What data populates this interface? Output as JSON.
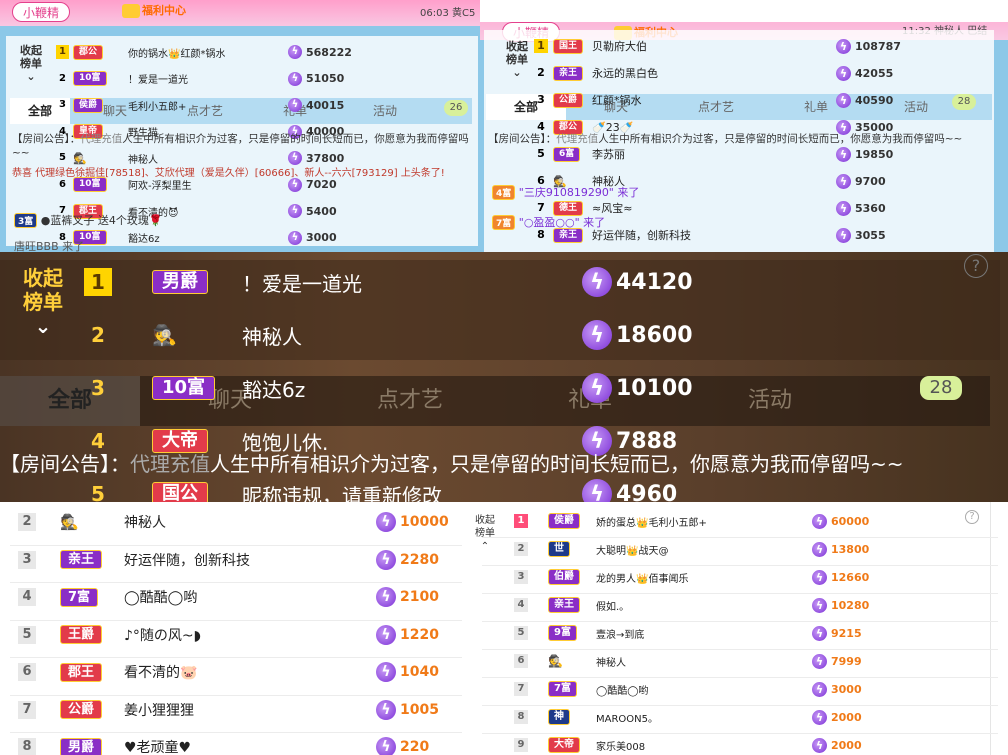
{
  "panel1": {
    "pill": "小鞭精",
    "welfare": "福利中心",
    "clock": "06:03",
    "clock_suffix": "黄C5",
    "collapse": "收起\n榜单",
    "tabs": [
      "全部",
      "聊天",
      "点才艺",
      "礼单",
      "活动"
    ],
    "tab_count": "26",
    "rows": [
      {
        "rank": "1",
        "badge": "郡公",
        "name": "你的锅水👑红颜*锅水",
        "score": "568222"
      },
      {
        "rank": "2",
        "badge": "10富",
        "name": "！爱是一道光",
        "score": "51050"
      },
      {
        "rank": "3",
        "badge": "侯爵",
        "name": "毛利小五郎+",
        "score": "40015"
      },
      {
        "rank": "4",
        "badge": "皇帝",
        "name": "野生猫",
        "score": "40000"
      },
      {
        "rank": "5",
        "badge": "",
        "name": "神秘人",
        "score": "37800"
      },
      {
        "rank": "6",
        "badge": "10富",
        "name": "阿欢-浮梨里生",
        "score": "7020"
      },
      {
        "rank": "7",
        "badge": "郡王",
        "name": "看不清的😈",
        "score": "5400"
      },
      {
        "rank": "8",
        "badge": "10富",
        "name": "豁达6z",
        "score": "3000"
      }
    ],
    "notice": "【房间公告】：",
    "notice_vip": "代理充值",
    "notice_text": "人生中所有相识介为过客，只是停留的时间长短而已，你愿意为我而停留吗~~",
    "congrats": "恭喜 代理绿色徐掘佳[78518]、艾欣代理（爱是久伴）[60666]、新人--六六[793129] 上头条了!",
    "chat1_badge": "3富",
    "chat1": "●蓝裤叉子 送4个玫瑰🌹",
    "chat2": "唐旺BBB 来了"
  },
  "panel2": {
    "pill": "小鞭精",
    "welfare": "福利中心",
    "clock": "11:32",
    "clock_suffix": "神秘人 巴结",
    "collapse": "收起\n榜单",
    "tabs": [
      "全部",
      "聊天",
      "点才艺",
      "礼单",
      "活动"
    ],
    "tab_count": "28",
    "rows": [
      {
        "rank": "1",
        "badge": "国王",
        "name": "贝勒府大伯",
        "score": "108787"
      },
      {
        "rank": "2",
        "badge": "亲王",
        "name": "永远的黑白色",
        "score": "42055"
      },
      {
        "rank": "3",
        "badge": "公爵",
        "name": "红颜*锅水",
        "score": "40590"
      },
      {
        "rank": "4",
        "badge": "郡公",
        "name": "🍼23🍼",
        "score": "35000"
      },
      {
        "rank": "5",
        "badge": "6富",
        "name": "李苏丽",
        "score": "19850"
      },
      {
        "rank": "6",
        "badge": "",
        "name": "神秘人",
        "score": "9700"
      },
      {
        "rank": "7",
        "badge": "德王",
        "name": "≈风宝≈",
        "score": "5360"
      },
      {
        "rank": "8",
        "badge": "亲王",
        "name": "好运伴随，创新科技",
        "score": "3055"
      }
    ],
    "notice": "【房间公告】：",
    "notice_vip": "代理充值",
    "notice_text": "人生中所有相识介为过客，只是停留的时间长短而已，你愿意为我而停留吗~~",
    "chat1_badge": "4富",
    "chat1": "\"三庆910819290\" 来了",
    "chat2_badge": "7富",
    "chat2": "\"○盈盈○○\" 来了"
  },
  "panel3": {
    "collapse": "收起\n榜单",
    "tabs": [
      "全部",
      "聊天",
      "点才艺",
      "礼单",
      "活动"
    ],
    "tab_count": "28",
    "rows": [
      {
        "rank": "1",
        "badge": "男爵",
        "name": "！爱是一道光",
        "score": "44120"
      },
      {
        "rank": "2",
        "badge": "",
        "name": "神秘人",
        "score": "18600"
      },
      {
        "rank": "3",
        "badge": "10富",
        "name": "豁达6z",
        "score": "10100"
      },
      {
        "rank": "4",
        "badge": "大帝",
        "name": "饱饱儿休.",
        "score": "7888"
      },
      {
        "rank": "5",
        "badge": "国公",
        "name": "昵称违规，请重新修改",
        "score": "4960"
      }
    ],
    "notice": "【房间公告】：",
    "notice_vip": "代理充值",
    "notice_text": "人生中所有相识介为过客，只是停留的时间长短而已，你愿意为我而停留吗~~"
  },
  "panel4": {
    "rows": [
      {
        "rank": "2",
        "badge": "",
        "name": "神秘人",
        "score": "10000"
      },
      {
        "rank": "3",
        "badge": "亲王",
        "name": "好运伴随，创新科技",
        "score": "2280"
      },
      {
        "rank": "4",
        "badge": "7富",
        "name": "◯酷酷◯哟",
        "score": "2100"
      },
      {
        "rank": "5",
        "badge": "王爵",
        "name": "♪°随の风~◗",
        "score": "1220"
      },
      {
        "rank": "6",
        "badge": "郡王",
        "name": "看不清的🐷",
        "score": "1040"
      },
      {
        "rank": "7",
        "badge": "公爵",
        "name": "姜小狸狸狸",
        "score": "1005"
      },
      {
        "rank": "8",
        "badge": "男爵",
        "name": "♥老顽童♥",
        "score": "220"
      }
    ]
  },
  "panel5": {
    "collapse": "收起\n榜单",
    "rows": [
      {
        "rank": "1",
        "badge": "侯爵",
        "name": "娇的蛋总👑毛利小五郎+",
        "score": "60000"
      },
      {
        "rank": "2",
        "badge": "世",
        "name": "大聪明👑战天@",
        "score": "13800"
      },
      {
        "rank": "3",
        "badge": "伯爵",
        "name": "龙的男人👑佰事闻乐",
        "score": "12660"
      },
      {
        "rank": "4",
        "badge": "亲王",
        "name": "假如.。",
        "score": "10280"
      },
      {
        "rank": "5",
        "badge": "9富",
        "name": "壹浪→到底",
        "score": "9215"
      },
      {
        "rank": "6",
        "badge": "",
        "name": "神秘人",
        "score": "7999"
      },
      {
        "rank": "7",
        "badge": "7富",
        "name": "◯酷酷◯哟",
        "score": "3000"
      },
      {
        "rank": "8",
        "badge": "神",
        "name": "MAROON5。",
        "score": "2000"
      },
      {
        "rank": "9",
        "badge": "大帝",
        "name": "家乐美008",
        "score": "2000"
      }
    ]
  },
  "colors": {
    "accent_purple": "#7b2fd6",
    "score_orange": "#f07a18",
    "rank_gold": "#ffd400",
    "pink": "#ff4d79"
  }
}
